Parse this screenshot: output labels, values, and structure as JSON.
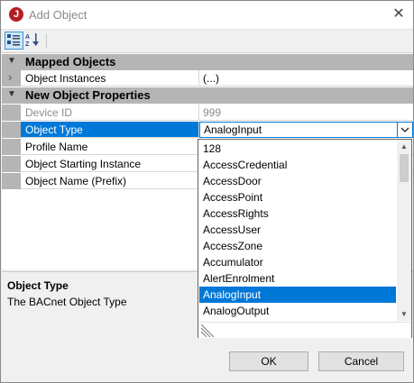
{
  "window": {
    "title": "Add Object",
    "close_glyph": "✕",
    "app_icon_glyph": "J"
  },
  "toolbar": {
    "buttons": [
      {
        "name": "categorized-view-icon",
        "active": true
      },
      {
        "name": "alphabetical-sort-icon",
        "active": false
      }
    ]
  },
  "grid": {
    "categories": [
      {
        "label": "Mapped Objects",
        "glyph": "▼"
      },
      {
        "label": "New Object Properties",
        "glyph": "▼"
      }
    ],
    "mapped": [
      {
        "name": "Object Instances",
        "value": "(...)",
        "expander": "›"
      }
    ],
    "properties": [
      {
        "name": "Device ID",
        "value": "999"
      },
      {
        "name": "Object Type",
        "value": "AnalogInput"
      },
      {
        "name": "Profile Name",
        "value": ""
      },
      {
        "name": "Object Starting Instance",
        "value": ""
      },
      {
        "name": "Object Name (Prefix)",
        "value": ""
      }
    ]
  },
  "dropdown": {
    "options": [
      "128",
      "AccessCredential",
      "AccessDoor",
      "AccessPoint",
      "AccessRights",
      "AccessUser",
      "AccessZone",
      "Accumulator",
      "AlertEnrolment",
      "AnalogInput",
      "AnalogOutput"
    ],
    "selected": "AnalogInput",
    "scroll_fraction": 0.05
  },
  "description": {
    "title": "Object Type",
    "text": "The BACnet Object Type"
  },
  "buttons": {
    "ok": "OK",
    "cancel": "Cancel"
  },
  "colors": {
    "selection": "#0078d7",
    "category": "#b5b5b5",
    "brand": "#b21f24"
  }
}
